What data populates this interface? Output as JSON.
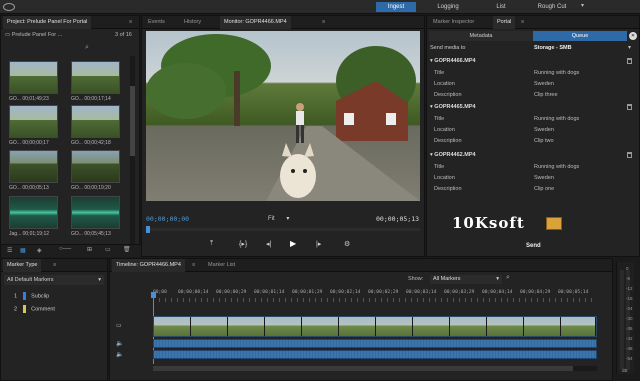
{
  "topbar": {
    "workspaces": [
      "Ingest",
      "Logging",
      "List",
      "Rough Cut"
    ],
    "active": "Ingest"
  },
  "project": {
    "title": "Project: Prelude Panel For Portal",
    "subtitle": "Prelude Panel For ...",
    "count": "3 of 16",
    "thumbs": [
      {
        "label": "GO... 00;01;49;23"
      },
      {
        "label": "GO... 00;00;17;14"
      },
      {
        "label": "GO... 00;00;00;17"
      },
      {
        "label": "GO... 00;00;42;18"
      },
      {
        "label": "GO... 00;00;05;13"
      },
      {
        "label": "GO... 00;00;19;20"
      },
      {
        "label": "Jag... 00;01;19;12"
      },
      {
        "label": "GO... 00;05;45;13"
      }
    ]
  },
  "monitor": {
    "tabs": [
      "Events",
      "History",
      "Monitor: GOPR4466.MP4"
    ],
    "timecode_in": "00;00;00;00",
    "timecode_out": "00;00;05;13",
    "zoom": "Fit"
  },
  "right": {
    "tabs": [
      "Marker Inspector",
      "Portal"
    ],
    "subtabs": [
      "Metadata",
      "Queue"
    ],
    "send_media_to": "Send media to",
    "destination": "Storage - SMB",
    "field_labels": [
      "Title",
      "Location",
      "Description"
    ],
    "clips": [
      {
        "name": "GOPR4466.MP4",
        "title": "Running with dogs",
        "location": "Sweden",
        "description": "Clip three"
      },
      {
        "name": "GOPR4465.MP4",
        "title": "Running with dogs",
        "location": "Sweden",
        "description": "Clip two"
      },
      {
        "name": "GOPR4462.MP4",
        "title": "Running with dogs",
        "location": "Sweden",
        "description": "Clip one"
      }
    ],
    "send_label": "Send",
    "watermark": "10Ksoft"
  },
  "markers": {
    "title": "Marker Type",
    "filter": "All Default Markers",
    "items": [
      {
        "num": "1",
        "label": "Subclip",
        "color": "#3a7fd5"
      },
      {
        "num": "2",
        "label": "Comment",
        "color": "#d8c94a"
      }
    ]
  },
  "timeline": {
    "tabs": [
      "Timeline: GOPR4466.MP4",
      "Marker List"
    ],
    "show_label": "Show:",
    "show_value": "All Markers",
    "ruler": [
      "00;00",
      "00;00;00;14",
      "00;00;00;29",
      "00;00;01;14",
      "00;00;01;29",
      "00;00;02;14",
      "00;00;02;29",
      "00;00;03;14",
      "00;00;03;29",
      "00;00;04;14",
      "00;00;04;29",
      "00;00;05;14"
    ]
  },
  "meter": {
    "labels": [
      "0",
      "-6",
      "-12",
      "-18",
      "-24",
      "-30",
      "-36",
      "-42",
      "-48",
      "-54",
      "dB"
    ]
  }
}
